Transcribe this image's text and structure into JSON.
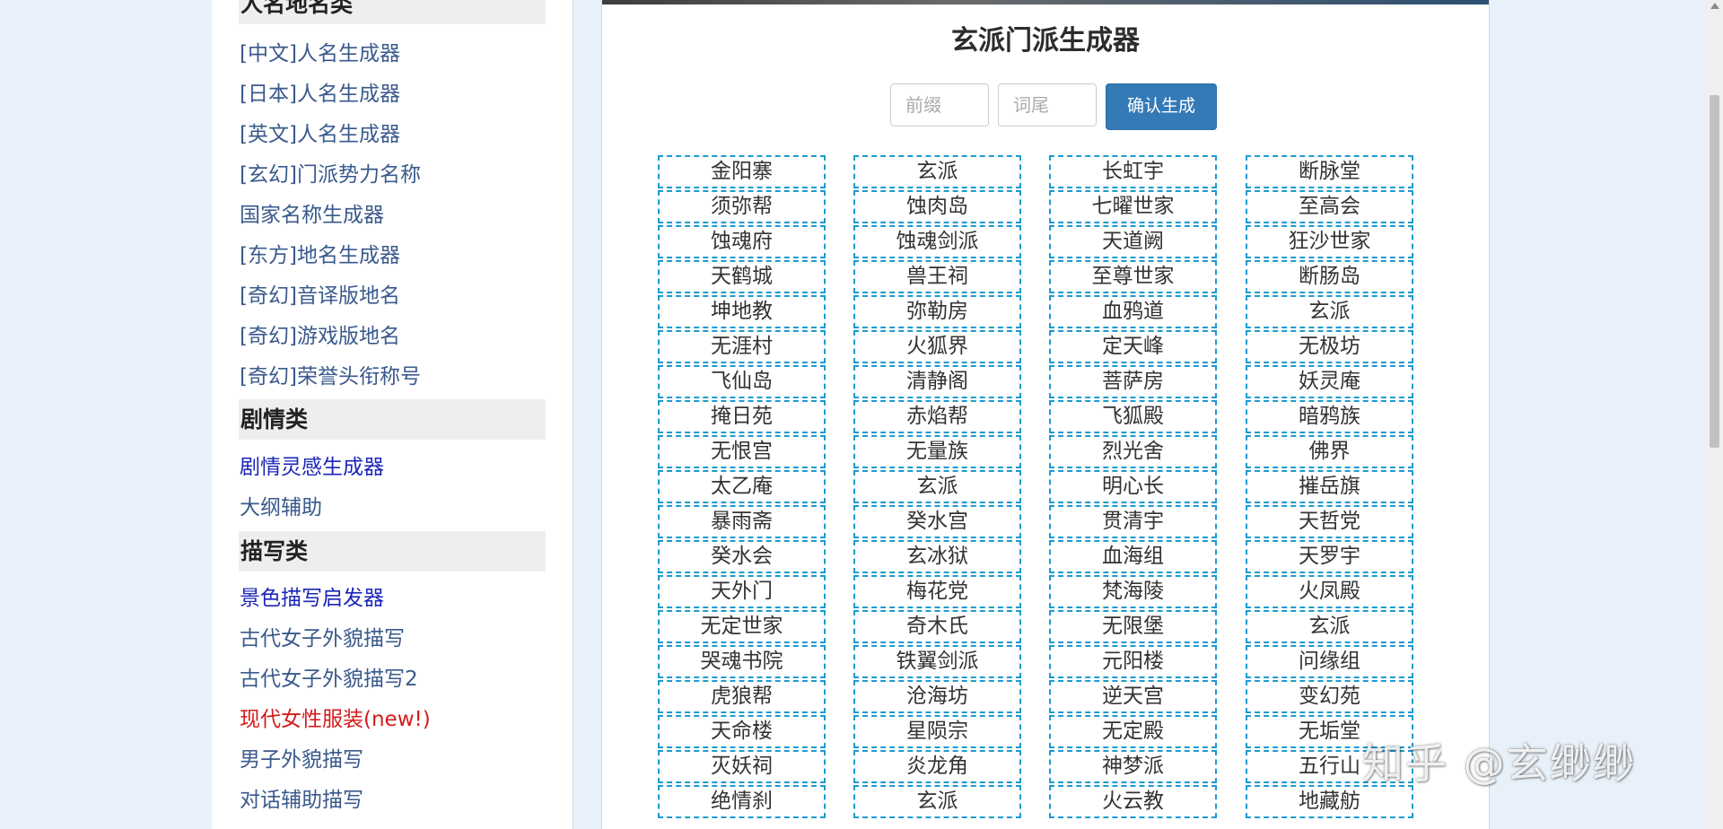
{
  "sidebar": {
    "sections": [
      {
        "header": "人名地名类",
        "links": [
          {
            "label": "[中文]人名生成器",
            "style": "default"
          },
          {
            "label": "[日本]人名生成器",
            "style": "default"
          },
          {
            "label": "[英文]人名生成器",
            "style": "default"
          },
          {
            "label": "[玄幻]门派势力名称",
            "style": "default"
          },
          {
            "label": "国家名称生成器",
            "style": "default"
          },
          {
            "label": "[东方]地名生成器",
            "style": "default"
          },
          {
            "label": "[奇幻]音译版地名",
            "style": "default"
          },
          {
            "label": "[奇幻]游戏版地名",
            "style": "default"
          },
          {
            "label": "[奇幻]荣誉头衔称号",
            "style": "default"
          }
        ]
      },
      {
        "header": "剧情类",
        "links": [
          {
            "label": "剧情灵感生成器",
            "style": "blue"
          },
          {
            "label": "大纲辅助",
            "style": "default"
          }
        ]
      },
      {
        "header": "描写类",
        "links": [
          {
            "label": "景色描写启发器",
            "style": "blue"
          },
          {
            "label": "古代女子外貌描写",
            "style": "default"
          },
          {
            "label": "古代女子外貌描写2",
            "style": "default"
          },
          {
            "label": "现代女性服装(new!)",
            "style": "red"
          },
          {
            "label": "男子外貌描写",
            "style": "default"
          },
          {
            "label": "对话辅助描写",
            "style": "default"
          }
        ]
      }
    ]
  },
  "main": {
    "title": "玄派门派生成器",
    "prefix_placeholder": "前缀",
    "suffix_placeholder": "词尾",
    "generate_label": "确认生成",
    "names": [
      [
        "金阳寨",
        "玄派",
        "长虹宇",
        "断脉堂"
      ],
      [
        "须弥帮",
        "蚀肉岛",
        "七曜世家",
        "至高会"
      ],
      [
        "蚀魂府",
        "蚀魂剑派",
        "天道阙",
        "狂沙世家"
      ],
      [
        "天鹤城",
        "兽王祠",
        "至尊世家",
        "断肠岛"
      ],
      [
        "坤地教",
        "弥勒房",
        "血鸦道",
        "玄派"
      ],
      [
        "无涯村",
        "火狐界",
        "定天峰",
        "无极坊"
      ],
      [
        "飞仙岛",
        "清静阁",
        "菩萨房",
        "妖灵庵"
      ],
      [
        "掩日苑",
        "赤焰帮",
        "飞狐殿",
        "暗鸦族"
      ],
      [
        "无恨宫",
        "无量族",
        "烈光舍",
        "佛界"
      ],
      [
        "太乙庵",
        "玄派",
        "明心长",
        "摧岳旗"
      ],
      [
        "暴雨斋",
        "癸水宫",
        "贯清宇",
        "天哲党"
      ],
      [
        "癸水会",
        "玄冰狱",
        "血海组",
        "天罗宇"
      ],
      [
        "天外门",
        "梅花党",
        "梵海陵",
        "火凤殿"
      ],
      [
        "无定世家",
        "奇木氏",
        "无限堡",
        "玄派"
      ],
      [
        "哭魂书院",
        "铁翼剑派",
        "元阳楼",
        "问缘组"
      ],
      [
        "虎狼帮",
        "沧海坊",
        "逆天宫",
        "变幻苑"
      ],
      [
        "天命楼",
        "星陨宗",
        "无定殿",
        "无垢堂"
      ],
      [
        "灭妖祠",
        "炎龙角",
        "神梦派",
        "五行山"
      ],
      [
        "绝情刹",
        "玄派",
        "火云教",
        "地藏舫"
      ]
    ]
  },
  "watermark": "知乎 @玄缈缈",
  "colors": {
    "page_bg": "#e8f1f9",
    "cell_border": "#1c9bd1",
    "button_bg": "#337ab7",
    "link_default": "#3a5a8c",
    "link_blue": "#1a25b8",
    "link_red": "#d41b1b"
  }
}
